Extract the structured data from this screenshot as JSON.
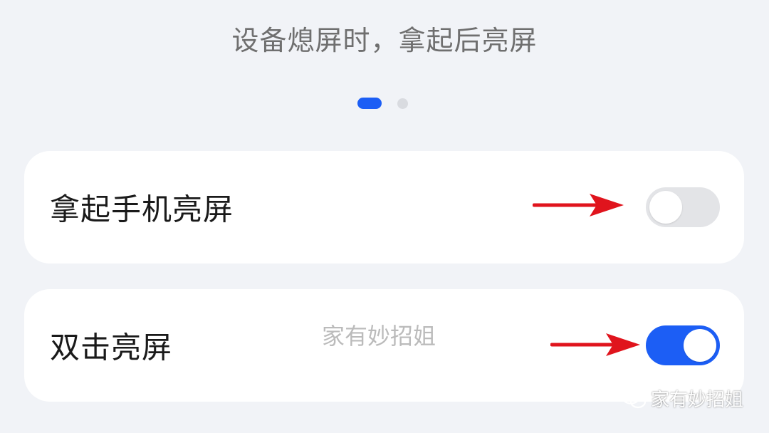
{
  "header": {
    "subtitle": "设备熄屏时，拿起后亮屏"
  },
  "pager": {
    "pages": 2,
    "active_index": 0,
    "active_color": "#1c5ef5"
  },
  "settings": [
    {
      "label": "拿起手机亮屏",
      "enabled": false
    },
    {
      "label": "双击亮屏",
      "enabled": true
    }
  ],
  "annotations": {
    "arrow_color": "#e0141d"
  },
  "watermark": {
    "center_text": "家有妙招姐",
    "corner_text": "家有妙招姐",
    "corner_icon": "wechat-icon"
  },
  "colors": {
    "accent": "#1c5ef5",
    "toggle_off": "#e3e4e7",
    "background": "#f1f3f7"
  }
}
